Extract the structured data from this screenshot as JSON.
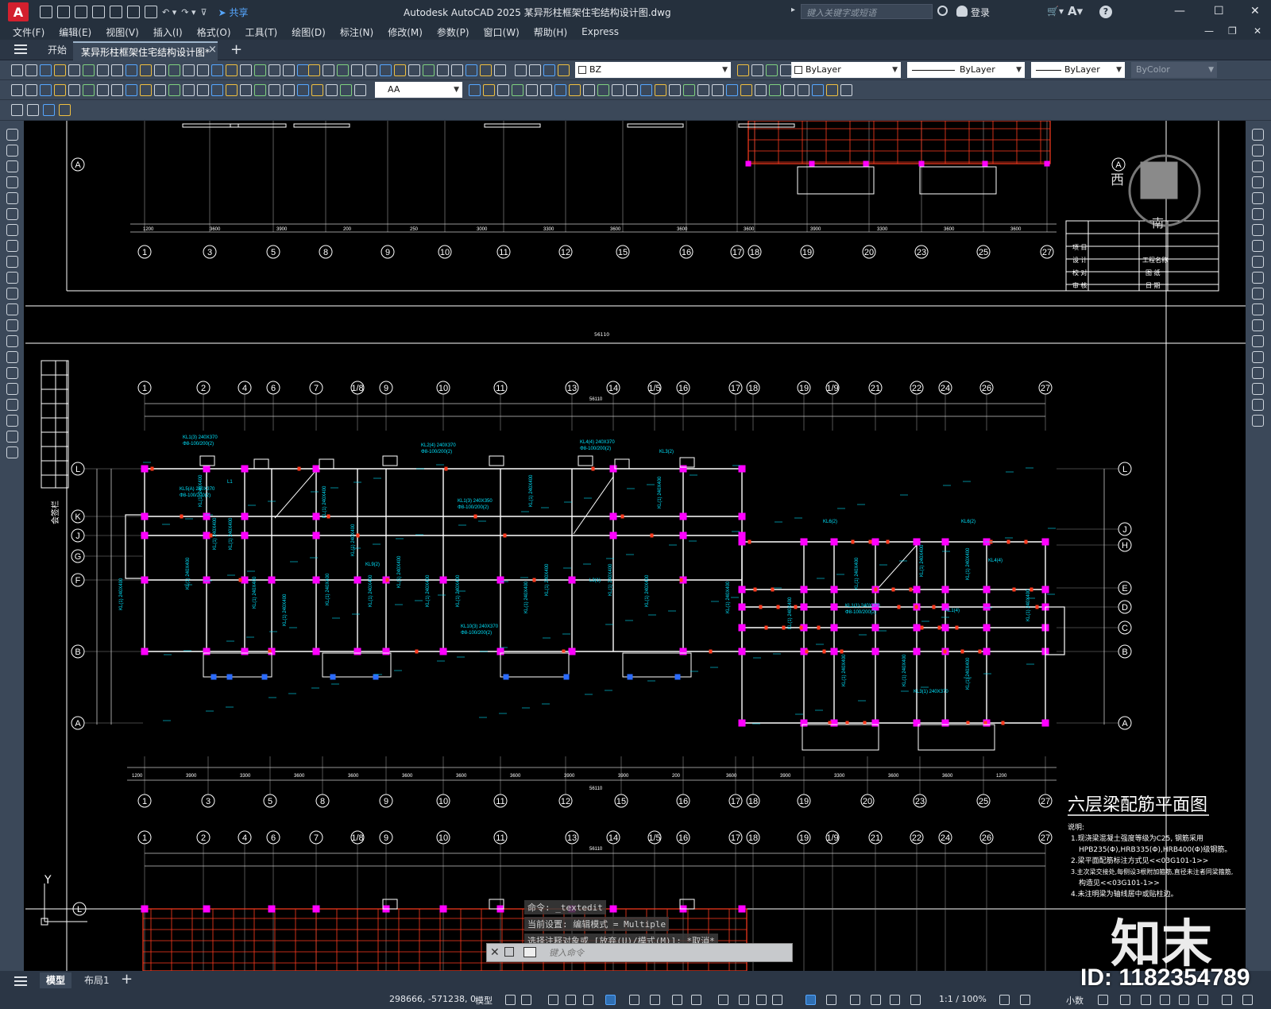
{
  "app": {
    "logo_letter": "A",
    "title": "Autodesk AutoCAD 2025    某异形柱框架住宅结构设计图.dwg",
    "share_label": "共享",
    "search_placeholder": "键入关键字或短语",
    "login_label": "登录",
    "help_label": "?"
  },
  "menu": [
    "文件(F)",
    "编辑(E)",
    "视图(V)",
    "插入(I)",
    "格式(O)",
    "工具(T)",
    "绘图(D)",
    "标注(N)",
    "修改(M)",
    "参数(P)",
    "窗口(W)",
    "帮助(H)",
    "Express"
  ],
  "tabs": {
    "start": "开始",
    "document": "某异形柱框架住宅结构设计图*",
    "close": "×",
    "new": "+"
  },
  "toolbar": {
    "layer_name": "BZ",
    "color": "ByLayer",
    "linetype": "ByLayer",
    "lineweight": "ByLayer",
    "plotstyle": "ByColor",
    "text_style": "AA"
  },
  "drawing": {
    "upper_dims": [
      "1200",
      "3600",
      "3900",
      "200",
      "250",
      "3000",
      "3300",
      "3600",
      "3600",
      "3600",
      "3900",
      "3300",
      "3600",
      "3600"
    ],
    "upper_total": "56110",
    "middle_axes_top": [
      "1",
      "2",
      "4",
      "6",
      "7",
      "1/8",
      "9",
      "10",
      "11",
      "13",
      "14",
      "1/5",
      "16",
      "17",
      "18",
      "19",
      "1/9",
      "21",
      "22",
      "24",
      "26",
      "27"
    ],
    "middle_axes_bottom": [
      "1",
      "3",
      "5",
      "8",
      "9",
      "10",
      "11",
      "12",
      "15",
      "16",
      "17",
      "18",
      "19",
      "20",
      "23",
      "25",
      "27"
    ],
    "row_axes_left": [
      "L",
      "K",
      "J",
      "G",
      "F",
      "B",
      "A"
    ],
    "row_axes_right": [
      "L",
      "J",
      "H",
      "E",
      "D",
      "C",
      "B",
      "A"
    ],
    "plan_title": "六层梁配筋平面图",
    "notes_heading": "说明:",
    "notes": [
      "1.现浇梁混凝土强度等级为C25, 钢筋采用",
      "HPB235(Φ),HRB335(Φ),HRB400(Φ)级钢筋。",
      "2.梁平面配筋标注方式见<<03G101-1>>",
      "3.主次梁交接处,每侧设3根附加箍筋,直径未注者同梁箍筋,",
      "构造见<<03G101-1>>",
      "4.未注明梁为轴线居中或贴柱边。"
    ],
    "title_block": [
      "项 目",
      "设 计",
      "校 对",
      "审 核",
      "工程名称",
      "图 纸",
      "日 期"
    ],
    "compass_west": "西",
    "compass_south": "南",
    "side_label": "会签栏",
    "ucs_y": "Y"
  },
  "command": {
    "history": [
      "命令: _textedit",
      "当前设置: 编辑模式 = Multiple",
      "选择注释对象或 [放弃(U)/模式(M)]: *取消*"
    ],
    "placeholder": "键入命令"
  },
  "layout_tabs": [
    "模型",
    "布局1"
  ],
  "status": {
    "coords": "298666, -571238, 0",
    "space": "模型",
    "scale": "1:1 / 100%",
    "units": "小数"
  },
  "watermark": {
    "logo": "知末",
    "id": "ID: 1182354789"
  },
  "colors": {
    "background": "#000000",
    "frame": "#ffffff",
    "grid": "#c8c8c8",
    "rebar_text": "#00e5ff",
    "columns": "#ff00ff",
    "red_beams": "#ff3b1f",
    "title_bar": "#25303d"
  }
}
